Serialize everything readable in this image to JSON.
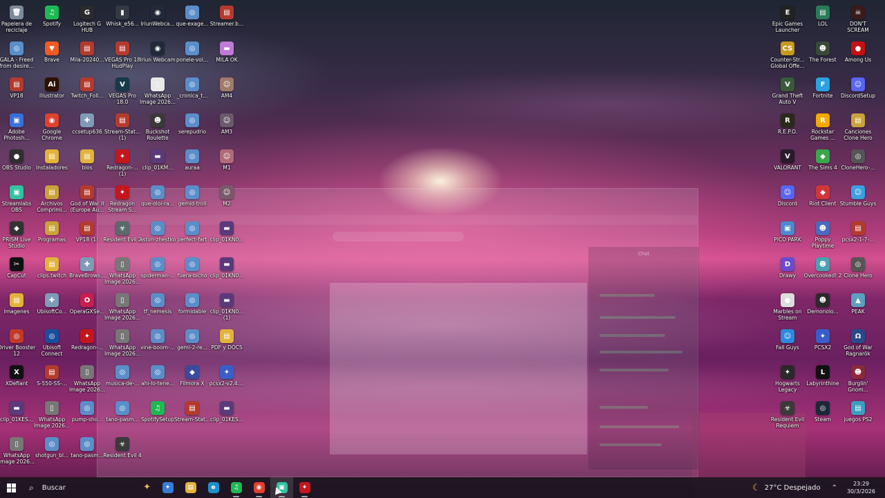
{
  "desktop_icons": [
    {
      "label": "Papelera de reciclaje",
      "glyph": "🗑",
      "color": "#7c8a9a",
      "icon": "recycle-bin-icon"
    },
    {
      "label": "Spotify",
      "glyph": "♫",
      "color": "#1db954",
      "icon": "spotify-icon"
    },
    {
      "label": "Logitech G HUB",
      "glyph": "G",
      "color": "#2b2b2b",
      "icon": "logitech-icon"
    },
    {
      "label": "Whisk_e56...",
      "glyph": "▮",
      "color": "#333a44",
      "icon": "file-icon"
    },
    {
      "label": "IriunWebca...",
      "glyph": "◉",
      "color": "#222a3a",
      "icon": "webcam-icon"
    },
    {
      "label": "que-exage...",
      "glyph": "◎",
      "color": "#5b8ec9",
      "icon": "audio-file-icon"
    },
    {
      "label": "Streamer.b...",
      "glyph": "▤",
      "color": "#b33b2e",
      "icon": "archive-icon"
    },
    {
      "label": "GALA - Freed from desire...",
      "glyph": "◎",
      "color": "#5b8ec9",
      "icon": "audio-file-icon"
    },
    {
      "label": "Brave",
      "glyph": "▼",
      "color": "#f05a24",
      "icon": "brave-icon"
    },
    {
      "label": "Mila-20240...",
      "glyph": "▤",
      "color": "#b33b2e",
      "icon": "archive-icon"
    },
    {
      "label": "VEGAS Pro 18 HudPlay",
      "glyph": "▤",
      "color": "#b33b2e",
      "icon": "archive-icon"
    },
    {
      "label": "Iriun Webcam",
      "glyph": "◉",
      "color": "#222a3a",
      "icon": "webcam-icon"
    },
    {
      "label": "ponele-vol...",
      "glyph": "◎",
      "color": "#5b8ec9",
      "icon": "audio-file-icon"
    },
    {
      "label": "MILA OK",
      "glyph": "▬",
      "color": "#c07bd6",
      "icon": "image-icon"
    },
    {
      "label": "VP18",
      "glyph": "▤",
      "color": "#b33b2e",
      "icon": "archive-icon"
    },
    {
      "label": "Illustrator",
      "glyph": "Ai",
      "color": "#2d1200",
      "icon": "illustrator-icon"
    },
    {
      "label": "Twitch_Foll...",
      "glyph": "▤",
      "color": "#b33b2e",
      "icon": "archive-icon"
    },
    {
      "label": "VEGAS Pro 18.0",
      "glyph": "V",
      "color": "#163a4a",
      "icon": "vegas-icon"
    },
    {
      "label": "WhatsApp Image 2026...",
      "glyph": "▯",
      "color": "#e8e8e8",
      "icon": "image-file-icon"
    },
    {
      "label": "_cronica_t...",
      "glyph": "◎",
      "color": "#5b8ec9",
      "icon": "audio-file-icon"
    },
    {
      "label": "AM4",
      "glyph": "☺",
      "color": "#a07a6a",
      "icon": "photo-icon"
    },
    {
      "label": "Adobe Photosh...",
      "glyph": "▣",
      "color": "#3a6fd8",
      "icon": "photoshop-icon"
    },
    {
      "label": "Google Chrome",
      "glyph": "◉",
      "color": "#e0412f",
      "icon": "chrome-icon"
    },
    {
      "label": "ccsetup636",
      "glyph": "✚",
      "color": "#7f9bb8",
      "icon": "installer-icon"
    },
    {
      "label": "Stream-Stat... (1)",
      "glyph": "▤",
      "color": "#b33b2e",
      "icon": "archive-icon"
    },
    {
      "label": "Buckshot Roulette",
      "glyph": "☻",
      "color": "#3a3a3a",
      "icon": "game-icon"
    },
    {
      "label": "serepudrio",
      "glyph": "◎",
      "color": "#5b8ec9",
      "icon": "audio-file-icon"
    },
    {
      "label": "AM3",
      "glyph": "☺",
      "color": "#6a5a6a",
      "icon": "photo-icon"
    },
    {
      "label": "OBS Studio",
      "glyph": "●",
      "color": "#302e31",
      "icon": "obs-icon"
    },
    {
      "label": "Instaladores",
      "glyph": "▤",
      "color": "#e2b33c",
      "icon": "folder-icon"
    },
    {
      "label": "bios",
      "glyph": "▤",
      "color": "#e2b33c",
      "icon": "folder-icon"
    },
    {
      "label": "Redragon-... (1)",
      "glyph": "✦",
      "color": "#c4161c",
      "icon": "redragon-icon"
    },
    {
      "label": "clip_01KM...",
      "glyph": "▬",
      "color": "#5a3a7a",
      "icon": "video-file-icon"
    },
    {
      "label": "auraa",
      "glyph": "◎",
      "color": "#5b8ec9",
      "icon": "audio-file-icon"
    },
    {
      "label": "M1",
      "glyph": "☺",
      "color": "#b06a7a",
      "icon": "photo-icon"
    },
    {
      "label": "Streamlabs OBS",
      "glyph": "▣",
      "color": "#31c3a2",
      "icon": "streamlabs-icon"
    },
    {
      "label": "Archivos Comprimi...",
      "glyph": "▤",
      "color": "#c9a23a",
      "icon": "folder-icon"
    },
    {
      "label": "God of War II (Europe Au...",
      "glyph": "▤",
      "color": "#b33b2e",
      "icon": "archive-icon"
    },
    {
      "label": "Redragon Stream S...",
      "glyph": "✦",
      "color": "#c4161c",
      "icon": "redragon-icon"
    },
    {
      "label": "que-oloi-ra...",
      "glyph": "◎",
      "color": "#5b8ec9",
      "icon": "audio-file-icon"
    },
    {
      "label": "gemid-troll",
      "glyph": "◎",
      "color": "#5b8ec9",
      "icon": "audio-file-icon"
    },
    {
      "label": "M2",
      "glyph": "☺",
      "color": "#7a5a6a",
      "icon": "photo-icon"
    },
    {
      "label": "PRISM Live Studio",
      "glyph": "◆",
      "color": "#333",
      "icon": "prism-icon"
    },
    {
      "label": "Programas",
      "glyph": "▤",
      "color": "#c9a23a",
      "icon": "folder-icon"
    },
    {
      "label": "VP18 (1)",
      "glyph": "▤",
      "color": "#b33b2e",
      "icon": "archive-icon"
    },
    {
      "label": "Resident Evil 2",
      "glyph": "☣",
      "color": "#5a6a6a",
      "icon": "game-icon"
    },
    {
      "label": "aston-zhestko",
      "glyph": "◎",
      "color": "#5b8ec9",
      "icon": "audio-file-icon"
    },
    {
      "label": "perfect-fart",
      "glyph": "◎",
      "color": "#5b8ec9",
      "icon": "audio-file-icon"
    },
    {
      "label": "clip_01KN0...",
      "glyph": "▬",
      "color": "#5a3a7a",
      "icon": "video-file-icon"
    },
    {
      "label": "CapCut",
      "glyph": "✂",
      "color": "#111",
      "icon": "capcut-icon"
    },
    {
      "label": "clips.twitch",
      "glyph": "▤",
      "color": "#e2b33c",
      "icon": "folder-icon"
    },
    {
      "label": "BraveBrows...",
      "glyph": "✚",
      "color": "#7f9bb8",
      "icon": "installer-icon"
    },
    {
      "label": "WhatsApp Image 2026...",
      "glyph": "▯",
      "color": "#777",
      "icon": "image-file-icon"
    },
    {
      "label": "spiderman-...",
      "glyph": "◎",
      "color": "#5b8ec9",
      "icon": "audio-file-icon"
    },
    {
      "label": "fuera-bicho",
      "glyph": "◎",
      "color": "#5b8ec9",
      "icon": "audio-file-icon"
    },
    {
      "label": "clip_01KN0...",
      "glyph": "▬",
      "color": "#5a3a7a",
      "icon": "video-file-icon"
    },
    {
      "label": "Imagenes",
      "glyph": "▤",
      "color": "#e2b33c",
      "icon": "folder-icon"
    },
    {
      "label": "UbisoftCo...",
      "glyph": "✚",
      "color": "#7f9bb8",
      "icon": "installer-icon"
    },
    {
      "label": "OperaGXSe...",
      "glyph": "O",
      "color": "#c81d4e",
      "icon": "opera-icon"
    },
    {
      "label": "WhatsApp Image 2026...",
      "glyph": "▯",
      "color": "#777",
      "icon": "image-file-icon"
    },
    {
      "label": "tf_nemesis",
      "glyph": "◎",
      "color": "#5b8ec9",
      "icon": "audio-file-icon"
    },
    {
      "label": "formidable",
      "glyph": "◎",
      "color": "#5b8ec9",
      "icon": "audio-file-icon"
    },
    {
      "label": "clip_01KN0... (1)",
      "glyph": "▬",
      "color": "#5a3a7a",
      "icon": "video-file-icon"
    },
    {
      "label": "Driver Booster 12",
      "glyph": "◎",
      "color": "#c0392b",
      "icon": "driver-booster-icon"
    },
    {
      "label": "Ubisoft Connect",
      "glyph": "◎",
      "color": "#1a4e9c",
      "icon": "ubisoft-icon"
    },
    {
      "label": "Redragon-...",
      "glyph": "✦",
      "color": "#c4161c",
      "icon": "redragon-icon"
    },
    {
      "label": "WhatsApp Image 2026...",
      "glyph": "▯",
      "color": "#777",
      "icon": "image-file-icon"
    },
    {
      "label": "vine-boom-...",
      "glyph": "◎",
      "color": "#5b8ec9",
      "icon": "audio-file-icon"
    },
    {
      "label": "gemi-2-re...",
      "glyph": "◎",
      "color": "#5b8ec9",
      "icon": "audio-file-icon"
    },
    {
      "label": "PDF y DOCS",
      "glyph": "▤",
      "color": "#e2b33c",
      "icon": "folder-icon"
    },
    {
      "label": "XDefiant",
      "glyph": "X",
      "color": "#111",
      "icon": "xdefiant-icon"
    },
    {
      "label": "S-550-SS-...",
      "glyph": "▤",
      "color": "#b33b2e",
      "icon": "archive-icon"
    },
    {
      "label": "WhatsApp Image 2026...",
      "glyph": "▯",
      "color": "#777",
      "icon": "image-file-icon"
    },
    {
      "label": "musica-de-...",
      "glyph": "◎",
      "color": "#5b8ec9",
      "icon": "audio-file-icon"
    },
    {
      "label": "ahi-lo-tene...",
      "glyph": "◎",
      "color": "#5b8ec9",
      "icon": "audio-file-icon"
    },
    {
      "label": "Filmora X",
      "glyph": "◆",
      "color": "#3b4a9c",
      "icon": "filmora-icon"
    },
    {
      "label": "pcsx2-v2.4....",
      "glyph": "✦",
      "color": "#3a5ec9",
      "icon": "pcsx2-icon"
    },
    {
      "label": "clip_01KES...",
      "glyph": "▬",
      "color": "#5a3a7a",
      "icon": "video-file-icon"
    },
    {
      "label": "WhatsApp Image 2026...",
      "glyph": "▯",
      "color": "#777",
      "icon": "image-file-icon"
    },
    {
      "label": "pump-sho...",
      "glyph": "◎",
      "color": "#5b8ec9",
      "icon": "audio-file-icon"
    },
    {
      "label": "tano-pasm...",
      "glyph": "◎",
      "color": "#5b8ec9",
      "icon": "audio-file-icon"
    },
    {
      "label": "SpotifySetup",
      "glyph": "♫",
      "color": "#1db954",
      "icon": "spotify-icon"
    },
    {
      "label": "Stream-Stat...",
      "glyph": "▤",
      "color": "#b33b2e",
      "icon": "archive-icon"
    },
    {
      "label": "clip_01KES...",
      "glyph": "▬",
      "color": "#5a3a7a",
      "icon": "video-file-icon"
    },
    {
      "label": "WhatsApp Image 2026...",
      "glyph": "▯",
      "color": "#777",
      "icon": "image-file-icon"
    },
    {
      "label": "shotgun_bl...",
      "glyph": "◎",
      "color": "#5b8ec9",
      "icon": "audio-file-icon"
    },
    {
      "label": "tano-pasm...",
      "glyph": "◎",
      "color": "#5b8ec9",
      "icon": "audio-file-icon"
    },
    {
      "label": "Resident Evil 4",
      "glyph": "☣",
      "color": "#3a3a3a",
      "icon": "game-icon"
    },
    {
      "label": "Epic Games Launcher",
      "glyph": "E",
      "color": "#222",
      "icon": "epic-icon"
    },
    {
      "label": "LOL",
      "glyph": "▤",
      "color": "#2a7a5a",
      "icon": "folder-icon"
    },
    {
      "label": "DON'T SCREAM",
      "glyph": "☠",
      "color": "#3a1a1a",
      "icon": "game-icon"
    },
    {
      "label": "Counter-Str... Global Offe...",
      "glyph": "CS",
      "color": "#c99a1a",
      "icon": "csgo-icon"
    },
    {
      "label": "The Forest",
      "glyph": "☻",
      "color": "#3a4a3a",
      "icon": "game-icon"
    },
    {
      "label": "Among Us",
      "glyph": "●",
      "color": "#c51111",
      "icon": "among-us-icon"
    },
    {
      "label": "Grand Theft Auto V",
      "glyph": "V",
      "color": "#3a5a3a",
      "icon": "gta-icon"
    },
    {
      "label": "Fortnite",
      "glyph": "F",
      "color": "#2aa1e0",
      "icon": "fortnite-icon"
    },
    {
      "label": "DiscordSetup",
      "glyph": "☺",
      "color": "#5865f2",
      "icon": "discord-icon"
    },
    {
      "label": "R.E.P.O.",
      "glyph": "R",
      "color": "#2a2a1a",
      "icon": "game-icon"
    },
    {
      "label": "Rockstar Games ...",
      "glyph": "R",
      "color": "#f2a900",
      "icon": "rockstar-icon"
    },
    {
      "label": "Canciones Clone Hero",
      "glyph": "▤",
      "color": "#c9a23a",
      "icon": "folder-icon"
    },
    {
      "label": "VALORANT",
      "glyph": "V",
      "color": "#2a1a2a",
      "icon": "valorant-icon"
    },
    {
      "label": "The Sims 4",
      "glyph": "◆",
      "color": "#3aa64a",
      "icon": "sims-icon"
    },
    {
      "label": "CloneHero-...",
      "glyph": "◎",
      "color": "#555",
      "icon": "clone-hero-icon"
    },
    {
      "label": "Discord",
      "glyph": "☺",
      "color": "#5865f2",
      "icon": "discord-icon"
    },
    {
      "label": "Riot Client",
      "glyph": "◆",
      "color": "#d13639",
      "icon": "riot-icon"
    },
    {
      "label": "Stumble Guys",
      "glyph": "☺",
      "color": "#3aa0e0",
      "icon": "game-icon"
    },
    {
      "label": "PICO PARK",
      "glyph": "▣",
      "color": "#4a8ad0",
      "icon": "game-icon"
    },
    {
      "label": "Poppy Playtime",
      "glyph": "☻",
      "color": "#4a6ac0",
      "icon": "game-icon"
    },
    {
      "label": "pcsx2-1-7-...",
      "glyph": "▤",
      "color": "#b33b2e",
      "icon": "archive-icon"
    },
    {
      "label": "Drawy",
      "glyph": "D",
      "color": "#6a4ad0",
      "icon": "game-icon"
    },
    {
      "label": "Overcooked! 2",
      "glyph": "☻",
      "color": "#4aa0b0",
      "icon": "game-icon"
    },
    {
      "label": "Clone Hero",
      "glyph": "◎",
      "color": "#555",
      "icon": "clone-hero-icon"
    },
    {
      "label": "Marbles on Stream",
      "glyph": "●",
      "color": "#ddd",
      "icon": "game-icon"
    },
    {
      "label": "Demonolo...",
      "glyph": "☻",
      "color": "#2a2a2a",
      "icon": "game-icon"
    },
    {
      "label": "PEAK",
      "glyph": "▲",
      "color": "#5aa0c0",
      "icon": "game-icon"
    },
    {
      "label": "Fall Guys",
      "glyph": "☺",
      "color": "#2a8ae0",
      "icon": "game-icon"
    },
    {
      "label": "PCSX2",
      "glyph": "✦",
      "color": "#3a5ec9",
      "icon": "pcsx2-icon"
    },
    {
      "label": "God of War Ragnarök",
      "glyph": "Ω",
      "color": "#2a4a8a",
      "icon": "game-icon"
    },
    {
      "label": "Hogwarts Legacy",
      "glyph": "✦",
      "color": "#2a2a2a",
      "icon": "game-icon"
    },
    {
      "label": "Labyrinthine",
      "glyph": "L",
      "color": "#111",
      "icon": "game-icon"
    },
    {
      "label": "Burglin' Gnom...",
      "glyph": "☻",
      "color": "#8a2a3a",
      "icon": "game-icon"
    },
    {
      "label": "Resident Evil Requiem",
      "glyph": "☣",
      "color": "#3a3a3a",
      "icon": "game-icon"
    },
    {
      "label": "Steam",
      "glyph": "◎",
      "color": "#1b2838",
      "icon": "steam-icon"
    },
    {
      "label": "juegos PS2",
      "glyph": "▤",
      "color": "#3aa0c0",
      "icon": "folder-icon"
    }
  ],
  "ghost_window": {
    "chat_title": "Chat"
  },
  "taskbar": {
    "search_placeholder": "Buscar",
    "apps": [
      {
        "name": "copilot-icon",
        "glyph": "✦",
        "color": "#3a7bd5"
      },
      {
        "name": "file-explorer-icon",
        "glyph": "▤",
        "color": "#e2b33c"
      },
      {
        "name": "edge-icon",
        "glyph": "e",
        "color": "#1e90c8"
      },
      {
        "name": "spotify-icon",
        "glyph": "♫",
        "color": "#1db954"
      },
      {
        "name": "chrome-icon",
        "glyph": "◉",
        "color": "#e0412f"
      },
      {
        "name": "streamlabs-icon",
        "glyph": "▣",
        "color": "#31c3a2"
      },
      {
        "name": "redragon-icon",
        "glyph": "✦",
        "color": "#c4161c"
      }
    ],
    "weather": "27°C Despejado",
    "time": "23:29",
    "date": "30/3/2026"
  }
}
